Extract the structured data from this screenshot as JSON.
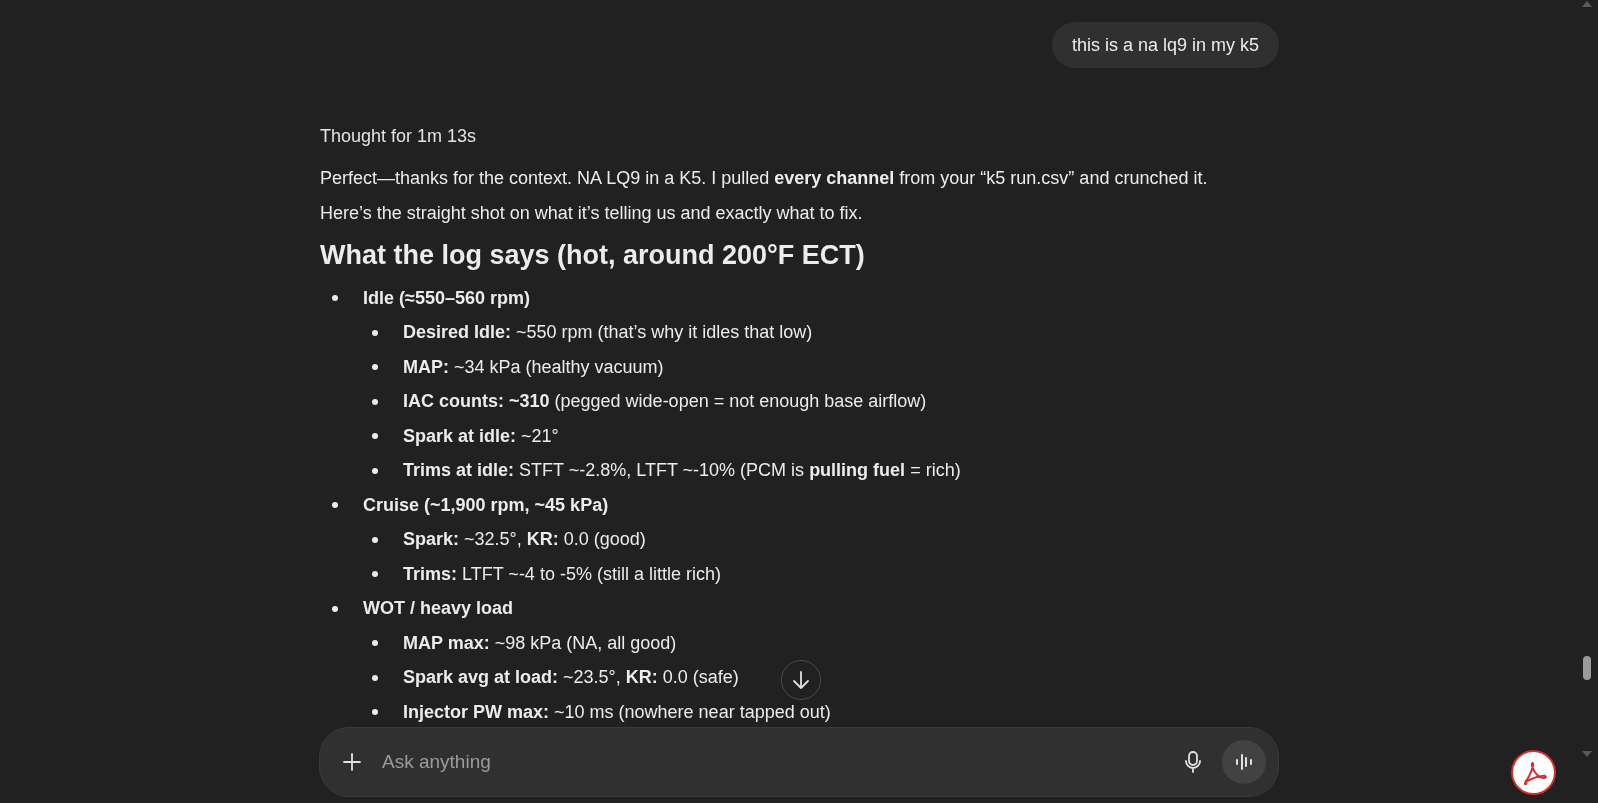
{
  "user_message": "this is a na lq9 in my k5",
  "thought_label": "Thought for 1m 13s",
  "intro": "Perfect—thanks for the context. NA LQ9 in a K5. I pulled **every channel** from your “k5 run.csv” and crunched it. Here’s the straight shot on what it’s telling us and exactly what to fix.",
  "heading": "What the log says (hot, around 200°F ECT)",
  "sections": [
    {
      "title": "Idle (≈550–560 rpm)",
      "items": [
        "**Desired Idle:** ~550 rpm (that’s why it idles that low)",
        "**MAP:** ~34 kPa (healthy vacuum)",
        "**IAC counts: ~310** (pegged wide-open = not enough base airflow)",
        "**Spark at idle:** ~21°",
        "**Trims at idle:** STFT ~-2.8%, LTFT ~-10% (PCM is **pulling fuel** = rich)"
      ]
    },
    {
      "title": "Cruise (~1,900 rpm, ~45 kPa)",
      "items": [
        "**Spark:** ~32.5°, **KR:** 0.0 (good)",
        "**Trims:** LTFT ~-4 to -5% (still a little rich)"
      ]
    },
    {
      "title": "WOT / heavy load",
      "items": [
        "**MAP max:** ~98 kPa (NA, all good)",
        "**Spark avg at load:** ~23.5°, **KR:** 0.0 (safe)",
        "**Injector PW max:** ~10 ms (nowhere near tapped out)"
      ]
    }
  ],
  "composer": {
    "placeholder": "Ask anything"
  }
}
